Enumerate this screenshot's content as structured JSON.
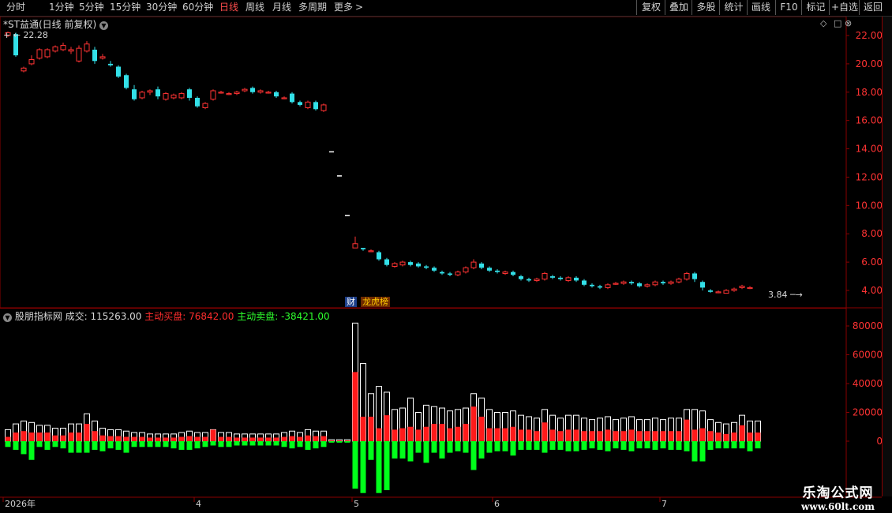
{
  "toolbar": {
    "periods": [
      "分时",
      "1分钟",
      "5分钟",
      "15分钟",
      "30分钟",
      "60分钟",
      "日线",
      "周线",
      "月线",
      "多周期",
      "更多"
    ],
    "active_period": "日线",
    "more_arrow": ">",
    "right_buttons": [
      "复权",
      "叠加",
      "多股",
      "统计",
      "画线",
      "F10",
      "标记",
      "+自选",
      "返回"
    ]
  },
  "main": {
    "stock_title": "*ST益通(日线 前复权)",
    "high_marker": "22.28",
    "low_marker": "3.84",
    "badges": [
      "财",
      "龙虎榜"
    ],
    "price_ticks": [
      "22.00",
      "20.00",
      "18.00",
      "16.00",
      "14.00",
      "12.00",
      "10.00",
      "8.00",
      "6.00",
      "4.00"
    ]
  },
  "indicator": {
    "name": "股朋指标网",
    "volume_label": "成交: 115263.00",
    "buy_label": "主动买盘: 76842.00",
    "sell_label": "主动卖盘: -38421.00",
    "vol_ticks": [
      "80000",
      "60000",
      "40000",
      "20000",
      "0"
    ]
  },
  "time_axis": [
    "2026年",
    "4",
    "5",
    "6",
    "7"
  ],
  "watermark": {
    "name": "乐淘公式网",
    "url": "www.60lt.com"
  },
  "colors": {
    "up": "#ff3333",
    "down": "#33e0e8",
    "buy": "#ff1a1a",
    "sell": "#00ff1a",
    "grid": "#8a0000",
    "axis_text": "#d0d0d0",
    "active": "#ff4d4d"
  },
  "chart_data": {
    "type": "candlestick",
    "ylim": [
      3,
      23
    ],
    "candles": [
      [
        22.0,
        22.2,
        22.28,
        21.9
      ],
      [
        22.1,
        20.6,
        22.2,
        20.5
      ],
      [
        19.5,
        19.7,
        19.8,
        19.4
      ],
      [
        20.0,
        20.3,
        20.6,
        19.9
      ],
      [
        20.4,
        21.0,
        21.1,
        20.3
      ],
      [
        20.5,
        21.0,
        21.1,
        20.4
      ],
      [
        20.9,
        21.2,
        21.3,
        20.8
      ],
      [
        21.0,
        21.3,
        21.5,
        20.9
      ],
      [
        20.9,
        21.0,
        21.2,
        20.7
      ],
      [
        20.2,
        21.1,
        21.3,
        20.1
      ],
      [
        20.9,
        21.4,
        21.6,
        20.8
      ],
      [
        21.0,
        20.2,
        21.2,
        20.0
      ],
      [
        20.4,
        20.5,
        20.7,
        20.3
      ],
      [
        20.0,
        19.9,
        20.2,
        19.8
      ],
      [
        19.8,
        19.1,
        19.9,
        19.0
      ],
      [
        19.2,
        18.3,
        19.3,
        18.2
      ],
      [
        18.2,
        17.5,
        18.5,
        17.4
      ],
      [
        17.6,
        18.0,
        18.1,
        17.5
      ],
      [
        18.0,
        18.1,
        18.2,
        17.8
      ],
      [
        18.2,
        17.7,
        18.4,
        17.5
      ],
      [
        17.5,
        17.9,
        18.0,
        17.4
      ],
      [
        17.6,
        17.8,
        17.9,
        17.5
      ],
      [
        17.6,
        17.9,
        18.0,
        17.5
      ],
      [
        18.2,
        17.6,
        18.3,
        17.4
      ],
      [
        17.6,
        17.0,
        17.7,
        16.9
      ],
      [
        16.9,
        17.2,
        17.3,
        16.8
      ],
      [
        17.5,
        18.1,
        18.2,
        17.4
      ],
      [
        18.0,
        18.0,
        18.1,
        17.9
      ],
      [
        17.9,
        17.9,
        18.0,
        17.8
      ],
      [
        17.9,
        18.0,
        18.1,
        17.8
      ],
      [
        18.1,
        18.2,
        18.3,
        18.0
      ],
      [
        18.3,
        18.0,
        18.4,
        17.9
      ],
      [
        18.0,
        18.1,
        18.2,
        17.9
      ],
      [
        18.0,
        18.0,
        18.1,
        17.9
      ],
      [
        18.0,
        17.7,
        18.1,
        17.6
      ],
      [
        17.6,
        17.6,
        17.7,
        17.5
      ],
      [
        17.9,
        17.3,
        18.0,
        17.2
      ],
      [
        17.3,
        17.1,
        17.4,
        17.0
      ],
      [
        16.9,
        17.3,
        17.4,
        16.8
      ],
      [
        17.3,
        16.8,
        17.4,
        16.7
      ],
      [
        16.7,
        17.1,
        17.2,
        16.6
      ],
      [
        13.8,
        13.8,
        13.8,
        13.8
      ],
      [
        12.1,
        12.1,
        12.1,
        12.1
      ],
      [
        9.3,
        9.3,
        9.3,
        9.3
      ],
      [
        7.0,
        7.3,
        7.8,
        7.0
      ],
      [
        7.0,
        6.9,
        7.0,
        6.8
      ],
      [
        6.8,
        6.8,
        6.9,
        6.7
      ],
      [
        6.7,
        6.2,
        6.8,
        6.1
      ],
      [
        6.2,
        5.8,
        6.3,
        5.7
      ],
      [
        5.7,
        5.9,
        6.0,
        5.6
      ],
      [
        5.8,
        6.0,
        6.1,
        5.7
      ],
      [
        6.0,
        5.8,
        6.1,
        5.7
      ],
      [
        5.9,
        5.7,
        6.0,
        5.6
      ],
      [
        5.7,
        5.6,
        5.8,
        5.5
      ],
      [
        5.6,
        5.4,
        5.7,
        5.3
      ],
      [
        5.3,
        5.2,
        5.4,
        5.1
      ],
      [
        5.2,
        5.1,
        5.3,
        5.0
      ],
      [
        5.1,
        5.3,
        5.4,
        5.0
      ],
      [
        5.3,
        5.6,
        5.7,
        5.2
      ],
      [
        5.6,
        6.0,
        6.2,
        5.5
      ],
      [
        5.9,
        5.6,
        6.0,
        5.5
      ],
      [
        5.6,
        5.4,
        5.7,
        5.3
      ],
      [
        5.4,
        5.3,
        5.5,
        5.2
      ],
      [
        5.2,
        5.3,
        5.4,
        5.1
      ],
      [
        5.3,
        5.1,
        5.4,
        5.0
      ],
      [
        5.0,
        4.8,
        5.1,
        4.7
      ],
      [
        4.8,
        4.7,
        4.9,
        4.6
      ],
      [
        4.7,
        4.8,
        4.9,
        4.6
      ],
      [
        4.8,
        5.2,
        5.3,
        4.7
      ],
      [
        5.0,
        4.9,
        5.1,
        4.8
      ],
      [
        4.9,
        4.8,
        5.0,
        4.7
      ],
      [
        4.7,
        4.9,
        5.0,
        4.6
      ],
      [
        4.9,
        4.7,
        5.0,
        4.6
      ],
      [
        4.7,
        4.4,
        4.8,
        4.3
      ],
      [
        4.4,
        4.3,
        4.5,
        4.2
      ],
      [
        4.3,
        4.2,
        4.4,
        4.1
      ],
      [
        4.2,
        4.4,
        4.5,
        4.1
      ],
      [
        4.5,
        4.5,
        4.6,
        4.4
      ],
      [
        4.5,
        4.6,
        4.7,
        4.4
      ],
      [
        4.6,
        4.5,
        4.7,
        4.4
      ],
      [
        4.5,
        4.3,
        4.6,
        4.2
      ],
      [
        4.3,
        4.4,
        4.5,
        4.2
      ],
      [
        4.4,
        4.6,
        4.7,
        4.3
      ],
      [
        4.6,
        4.5,
        4.7,
        4.4
      ],
      [
        4.5,
        4.6,
        4.7,
        4.4
      ],
      [
        4.6,
        4.8,
        4.9,
        4.5
      ],
      [
        4.8,
        5.2,
        5.3,
        4.7
      ],
      [
        5.2,
        4.8,
        5.3,
        4.6
      ],
      [
        4.6,
        4.2,
        4.7,
        4.0
      ],
      [
        4.0,
        3.9,
        4.1,
        3.84
      ],
      [
        3.9,
        3.9,
        4.0,
        3.8
      ],
      [
        3.8,
        4.0,
        4.1,
        3.8
      ],
      [
        4.0,
        4.1,
        4.2,
        3.9
      ],
      [
        4.2,
        4.3,
        4.4,
        4.1
      ],
      [
        4.2,
        4.2,
        4.3,
        4.1
      ]
    ],
    "volume": [
      8000,
      12000,
      14000,
      13000,
      11000,
      11000,
      9000,
      9000,
      12000,
      12000,
      19000,
      14000,
      9000,
      8000,
      8000,
      7000,
      6000,
      6000,
      5000,
      5000,
      5000,
      5000,
      6000,
      7000,
      6000,
      6000,
      8000,
      6000,
      6000,
      5000,
      5000,
      5000,
      5000,
      5000,
      5000,
      6000,
      7000,
      6000,
      8000,
      7000,
      7000,
      1000,
      1000,
      1000,
      82000,
      54000,
      33000,
      38000,
      34000,
      22000,
      23000,
      30000,
      20000,
      25000,
      24000,
      23000,
      21000,
      22000,
      23000,
      33000,
      30000,
      22000,
      20000,
      20000,
      21000,
      18000,
      17000,
      16000,
      22000,
      18000,
      16000,
      18000,
      18000,
      16000,
      15000,
      16000,
      17000,
      15000,
      16000,
      17000,
      15000,
      15000,
      16000,
      15000,
      16000,
      16000,
      22000,
      22000,
      21000,
      15000,
      13000,
      12000,
      13000,
      18000,
      14000,
      14000
    ],
    "buy": [
      3000,
      6000,
      7000,
      6000,
      6000,
      6000,
      4000,
      4000,
      6000,
      6000,
      12000,
      7000,
      4000,
      3500,
      3500,
      3000,
      3000,
      3000,
      2500,
      2500,
      2500,
      2500,
      3000,
      3500,
      3000,
      3000,
      8000,
      3000,
      3000,
      2500,
      2500,
      2500,
      2500,
      2500,
      2500,
      3000,
      3500,
      3000,
      4000,
      3500,
      3500,
      500,
      500,
      500,
      48000,
      17000,
      17000,
      9000,
      18000,
      8000,
      9000,
      10000,
      8000,
      10000,
      12000,
      12000,
      9000,
      10000,
      12000,
      24000,
      17000,
      9000,
      9000,
      9000,
      10000,
      8000,
      8000,
      7000,
      13000,
      8000,
      7000,
      8000,
      8000,
      7000,
      7000,
      7000,
      8000,
      7000,
      7000,
      8000,
      7000,
      7000,
      7000,
      7000,
      7000,
      7000,
      15000,
      8000,
      9000,
      7000,
      6000,
      5000,
      6000,
      11000,
      6000,
      6000
    ],
    "sell": [
      -4000,
      -6000,
      -9000,
      -13000,
      -4000,
      -6000,
      -4000,
      -5000,
      -8000,
      -8000,
      -8000,
      -6000,
      -7000,
      -5000,
      -6000,
      -8000,
      -4000,
      -4000,
      -4000,
      -4000,
      -4000,
      -5000,
      -6000,
      -6000,
      -5000,
      -4000,
      -3000,
      -4000,
      -4000,
      -3000,
      -3000,
      -3000,
      -3000,
      -3000,
      -3000,
      -4000,
      -5000,
      -4000,
      -6000,
      -5000,
      -4000,
      -1000,
      -1000,
      -1000,
      -33000,
      -36000,
      -13000,
      -36000,
      -34000,
      -12000,
      -12000,
      -14000,
      -8000,
      -15000,
      -8000,
      -12000,
      -8000,
      -7000,
      -8000,
      -20000,
      -12000,
      -8000,
      -7000,
      -7000,
      -10000,
      -6000,
      -6000,
      -6000,
      -8000,
      -6000,
      -6000,
      -7000,
      -7000,
      -6000,
      -5000,
      -6000,
      -7000,
      -5000,
      -6000,
      -7000,
      -5000,
      -5000,
      -6000,
      -5000,
      -6000,
      -6000,
      -7000,
      -14000,
      -14000,
      -6000,
      -5000,
      -5000,
      -5000,
      -5000,
      -7000,
      -5000
    ]
  }
}
